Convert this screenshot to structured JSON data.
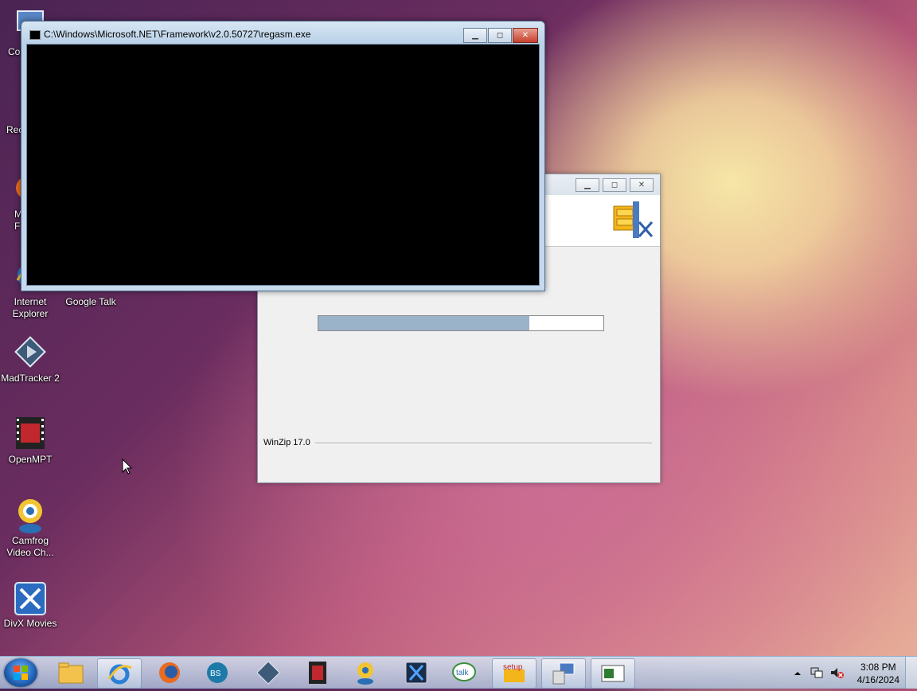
{
  "desktop": {
    "icons": [
      {
        "label": "Co",
        "id": "computer"
      },
      {
        "label": "Rec",
        "id": "recycle"
      },
      {
        "label": "M F",
        "id": "firefox"
      },
      {
        "label": "Internet Explorer",
        "id": "ie"
      },
      {
        "label": "Google Talk",
        "id": "gtalk"
      },
      {
        "label": "MadTracker 2",
        "id": "madtracker"
      },
      {
        "label": "OpenMPT",
        "id": "openmpt"
      },
      {
        "label": "Camfrog Video Ch...",
        "id": "camfrog"
      },
      {
        "label": "DivX Movies",
        "id": "divx"
      }
    ]
  },
  "console_window": {
    "title": "C:\\Windows\\Microsoft.NET\\Framework\\v2.0.50727\\regasm.exe",
    "minimize": "▁",
    "maximize": "◻",
    "close": "✕"
  },
  "winzip_window": {
    "progress": 0.74,
    "footer_label": "WinZip 17.0",
    "minimize": "▁",
    "maximize": "◻",
    "close": "✕"
  },
  "taskbar": {
    "items": [
      "explorer",
      "internet-explorer",
      "firefox",
      "bs-player",
      "madtracker",
      "openmpt",
      "camfrog",
      "divx",
      "google-talk",
      "winzip-setup",
      "regasm",
      "console"
    ],
    "clock_time": "3:08 PM",
    "clock_date": "4/16/2024"
  },
  "colors": {
    "accent": "#3a6ea5",
    "progress_fill": "#9bb3c9"
  }
}
